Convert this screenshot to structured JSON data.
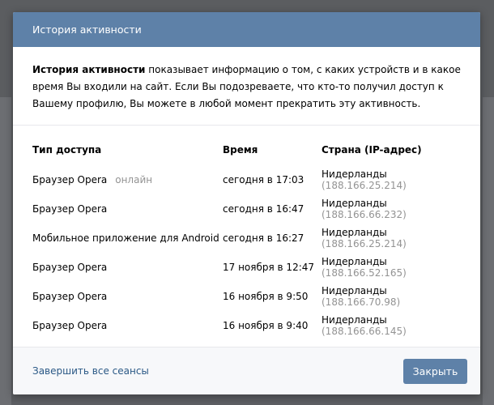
{
  "modal": {
    "title": "История активности",
    "intro_bold": "История активности",
    "intro_text": " показывает информацию о том, с каких устройств и в какое время Вы входили на сайт. Если Вы подозреваете, что кто-то получил доступ к Вашему профилю, Вы можете в любой момент прекратить эту активность.",
    "columns": [
      "Тип доступа",
      "Время",
      "Страна (IP-адрес)"
    ],
    "rows": [
      {
        "type": "Браузер Opera",
        "status": "онлайн",
        "time": "сегодня в 17:03",
        "country": "Нидерланды",
        "ip": "(188.166.25.214)"
      },
      {
        "type": "Браузер Opera",
        "status": "",
        "time": "сегодня в 16:47",
        "country": "Нидерланды",
        "ip": "(188.166.66.232)"
      },
      {
        "type": "Мобильное приложение для Android",
        "status": "",
        "time": "сегодня в 16:27",
        "country": "Нидерланды",
        "ip": "(188.166.25.214)"
      },
      {
        "type": "Браузер Opera",
        "status": "",
        "time": "17 ноября в 12:47",
        "country": "Нидерланды",
        "ip": "(188.166.52.165)"
      },
      {
        "type": "Браузер Opera",
        "status": "",
        "time": "16 ноября в 9:50",
        "country": "Нидерланды",
        "ip": "(188.166.70.98)"
      },
      {
        "type": "Браузер Opera",
        "status": "",
        "time": "16 ноября в 9:40",
        "country": "Нидерланды",
        "ip": "(188.166.66.145)"
      }
    ],
    "footer": {
      "end_sessions_label": "Завершить все сеансы",
      "close_label": "Закрыть"
    }
  },
  "colors": {
    "header_bg": "#5e81a8",
    "link": "#2a5885",
    "muted": "#939393",
    "backdrop": "#5b5d60"
  }
}
